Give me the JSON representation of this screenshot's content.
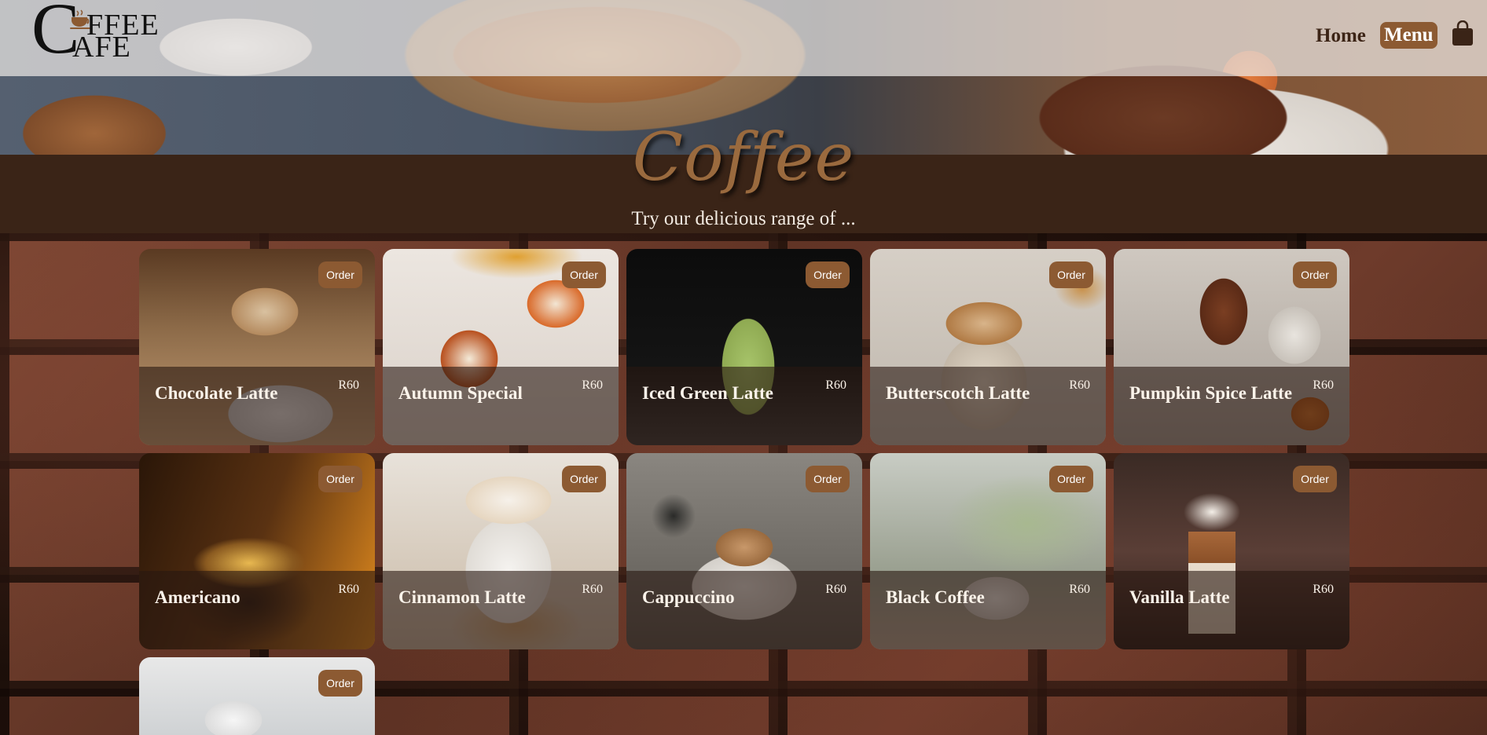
{
  "logo": {
    "line1": "FFEE",
    "line2": "AFE",
    "big_letter": "C"
  },
  "nav": {
    "home_label": "Home",
    "menu_label": "Menu"
  },
  "hero": {
    "title": "Coffee",
    "subtitle": "Try our delicious range of ..."
  },
  "order_label": "Order",
  "items": [
    {
      "name": "Chocolate Latte",
      "price": "R60"
    },
    {
      "name": "Autumn Special",
      "price": "R60"
    },
    {
      "name": "Iced Green Latte",
      "price": "R60"
    },
    {
      "name": "Butterscotch Latte",
      "price": "R60"
    },
    {
      "name": "Pumpkin Spice Latte",
      "price": "R60"
    },
    {
      "name": "Americano",
      "price": "R60"
    },
    {
      "name": "Cinnamon Latte",
      "price": "R60"
    },
    {
      "name": "Cappuccino",
      "price": "R60"
    },
    {
      "name": "Black Coffee",
      "price": "R60"
    },
    {
      "name": "Vanilla Latte",
      "price": "R60"
    },
    {
      "name": "",
      "price": ""
    }
  ],
  "colors": {
    "accent": "#8c5a32",
    "band": "#3a2417",
    "title": "#9a6a3e"
  }
}
